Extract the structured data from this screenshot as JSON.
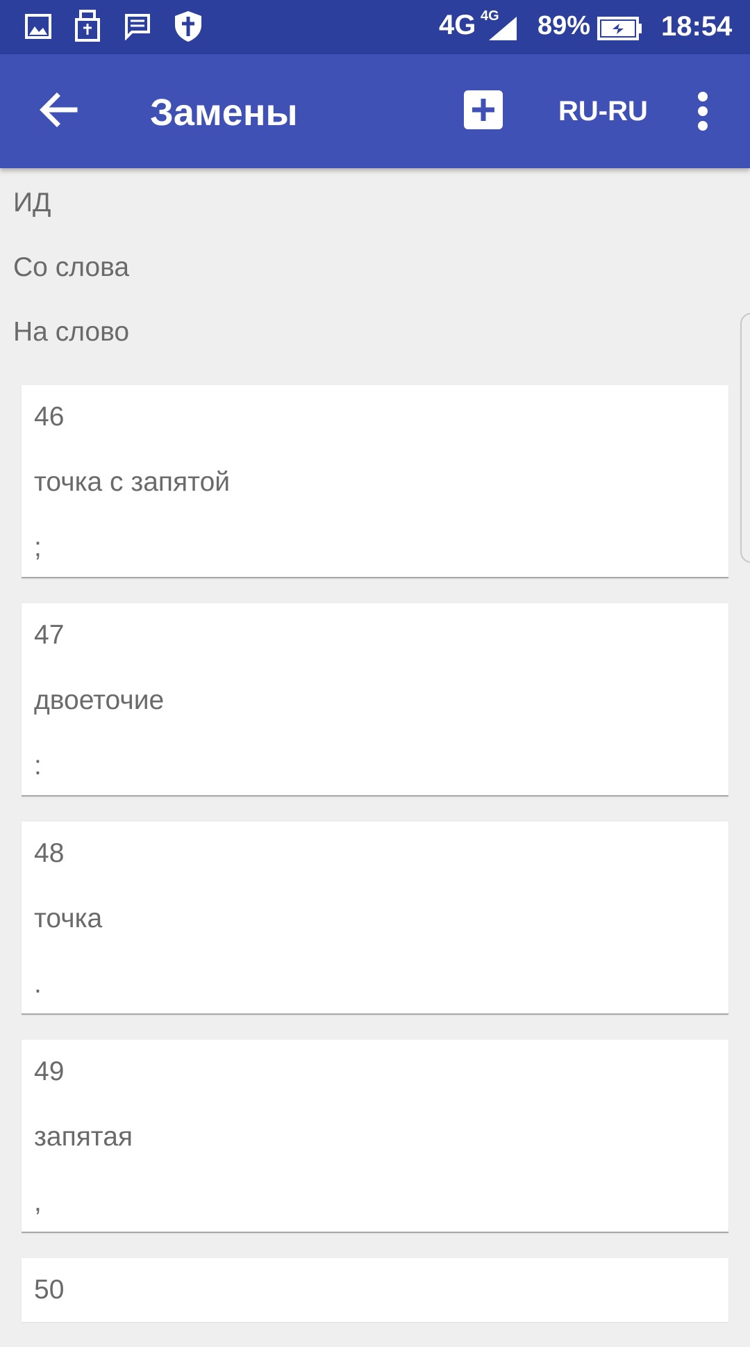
{
  "status_bar": {
    "network": "4G",
    "network_small": "4G",
    "battery": "89%",
    "time": "18:54"
  },
  "app_bar": {
    "title": "Замены",
    "lang": "RU-RU",
    "icons": [
      "back-arrow-icon",
      "add-icon",
      "more-vert-icon"
    ]
  },
  "header": {
    "labels": [
      "ИД",
      "Со слова",
      "На слово"
    ]
  },
  "items": [
    {
      "id": "46",
      "from": "точка с запятой",
      "to": ";"
    },
    {
      "id": "47",
      "from": "двоеточие",
      "to": ":"
    },
    {
      "id": "48",
      "from": "точка",
      "to": "."
    },
    {
      "id": "49",
      "from": "запятая",
      "to": ","
    },
    {
      "id": "50"
    }
  ],
  "colors": {
    "status_bar": "#2c3f9c",
    "app_bar": "#3f51b5",
    "background": "#efefef",
    "card": "#ffffff",
    "text_secondary": "#6a6a6a"
  }
}
